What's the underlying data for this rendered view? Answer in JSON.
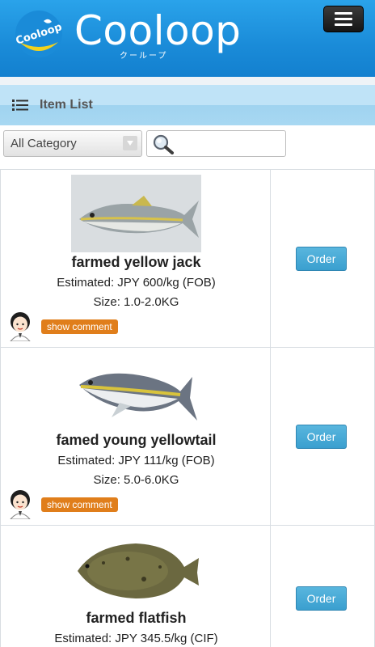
{
  "header": {
    "badge_text": "Cooloop",
    "logo_text": "Cooloop",
    "logo_kana": "クーループ",
    "menu_icon": "hamburger-icon"
  },
  "title_bar": {
    "icon": "list-icon",
    "title": "Item List"
  },
  "filters": {
    "category_selected": "All Category",
    "search_value": "",
    "search_icon": "magnifier-icon"
  },
  "products": [
    {
      "name": "farmed yellow jack",
      "price": "Estimated: JPY 600/kg (FOB)",
      "size": "Size: 1.0-2.0KG",
      "comment_label": "show comment",
      "order_label": "Order",
      "image": "yellow-jack-fish-image"
    },
    {
      "name": "famed young yellowtail",
      "price": "Estimated: JPY 111/kg (FOB)",
      "size": "Size: 5.0-6.0KG",
      "comment_label": "show comment",
      "order_label": "Order",
      "image": "yellowtail-fish-image"
    },
    {
      "name": "farmed flatfish",
      "price": "Estimated: JPY 345.5/kg (CIF)",
      "order_label": "Order",
      "image": "flatfish-image"
    }
  ],
  "colors": {
    "header_blue": "#1a8bd8",
    "title_bar": "#bfe3f7",
    "comment_orange": "#e07e1b",
    "order_blue": "#3a9fcf"
  }
}
